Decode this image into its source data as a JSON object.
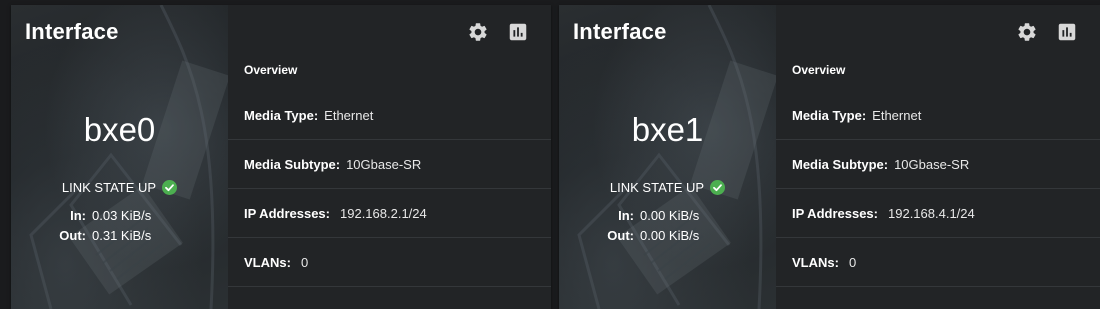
{
  "colors": {
    "page_bg": "#1a1b1d",
    "card_bg": "#222426",
    "status_ok": "#4caf50",
    "icon": "#d8d8d8"
  },
  "interfaces": [
    {
      "title": "Interface",
      "name": "bxe0",
      "link_state": "LINK STATE UP",
      "link_icon": "check-circle-icon",
      "in_label": "In:",
      "in_value": "0.03 KiB/s",
      "out_label": "Out:",
      "out_value": "0.31 KiB/s",
      "toolbar": {
        "settings_icon": "gear-icon",
        "stats_icon": "bar-chart-icon"
      },
      "overview_title": "Overview",
      "fields": [
        {
          "label": "Media Type:",
          "value": "Ethernet"
        },
        {
          "label": "Media Subtype:",
          "value": "10Gbase-SR"
        },
        {
          "label": "IP Addresses:",
          "value": "192.168.2.1/24"
        },
        {
          "label": "VLANs:",
          "value": "0"
        }
      ]
    },
    {
      "title": "Interface",
      "name": "bxe1",
      "link_state": "LINK STATE UP",
      "link_icon": "check-circle-icon",
      "in_label": "In:",
      "in_value": "0.00 KiB/s",
      "out_label": "Out:",
      "out_value": "0.00 KiB/s",
      "toolbar": {
        "settings_icon": "gear-icon",
        "stats_icon": "bar-chart-icon"
      },
      "overview_title": "Overview",
      "fields": [
        {
          "label": "Media Type:",
          "value": "Ethernet"
        },
        {
          "label": "Media Subtype:",
          "value": "10Gbase-SR"
        },
        {
          "label": "IP Addresses:",
          "value": "192.168.4.1/24"
        },
        {
          "label": "VLANs:",
          "value": "0"
        }
      ]
    }
  ]
}
